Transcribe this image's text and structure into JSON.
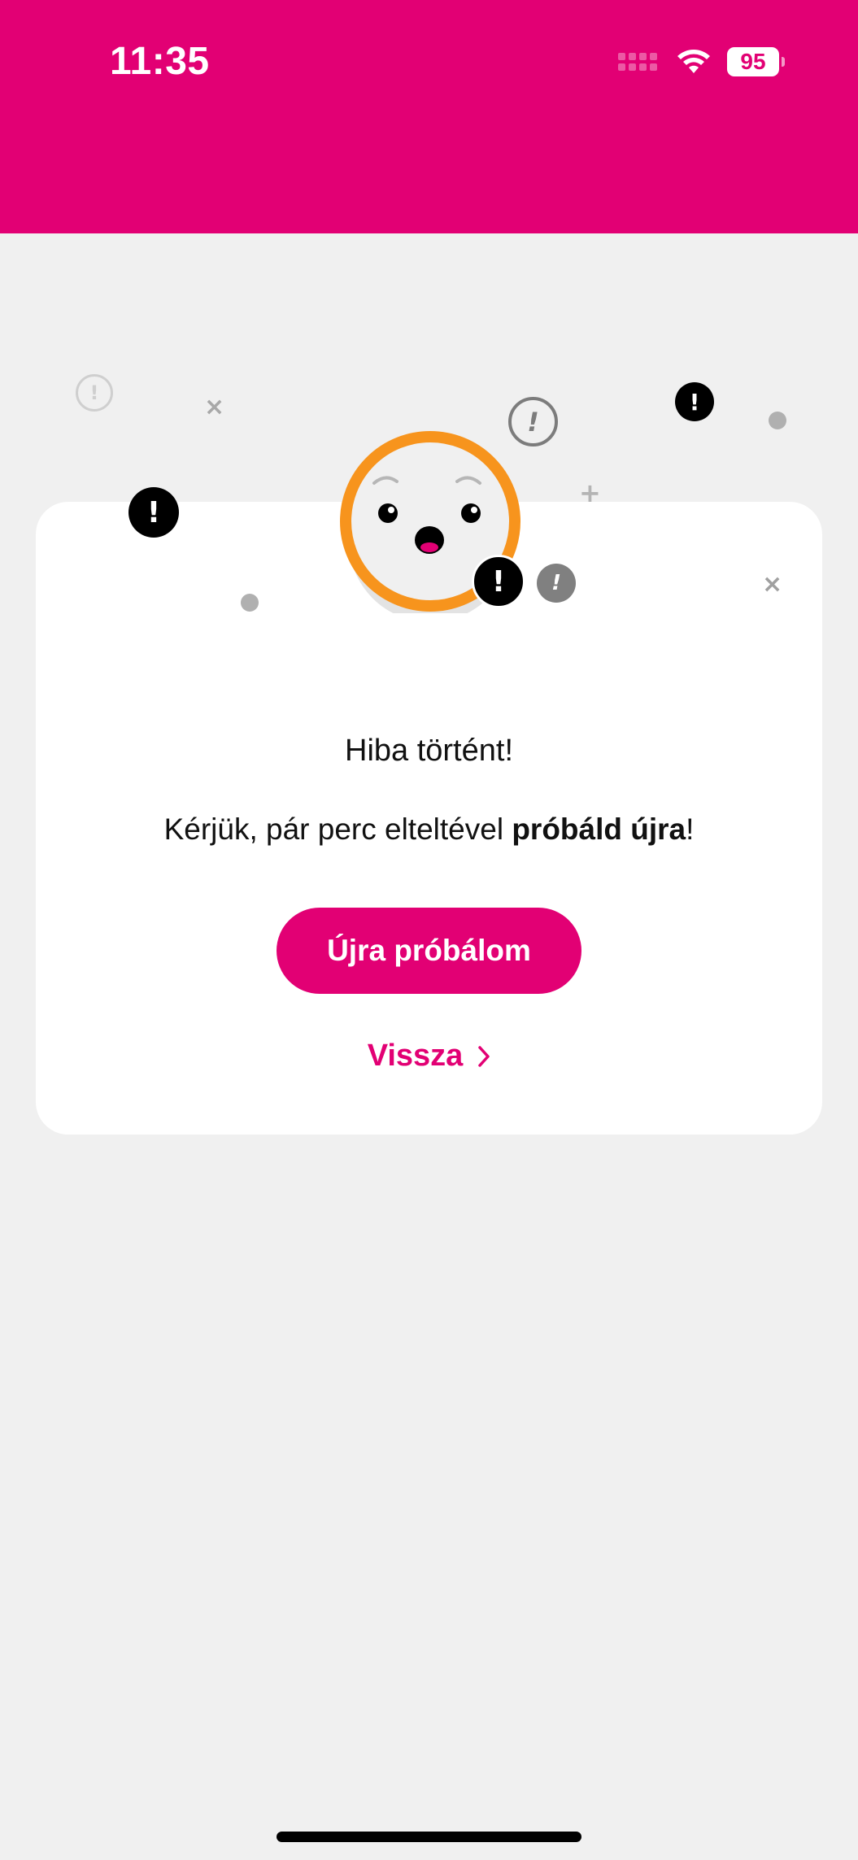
{
  "status_bar": {
    "time": "11:35",
    "battery": "95",
    "background_color": "#e20074"
  },
  "error": {
    "title": "Hiba történt!",
    "message_prefix": "Kérjük, pár perc elteltével ",
    "message_bold": "próbáld újra",
    "message_suffix": "!"
  },
  "actions": {
    "retry_label": "Újra próbálom",
    "back_label": "Vissza"
  },
  "colors": {
    "brand": "#e20074",
    "face_ring": "#f7941d"
  },
  "icons": {
    "face": "surprised-face-icon",
    "alert": "exclamation-icon",
    "back_arrow": "chevron-right-icon"
  }
}
